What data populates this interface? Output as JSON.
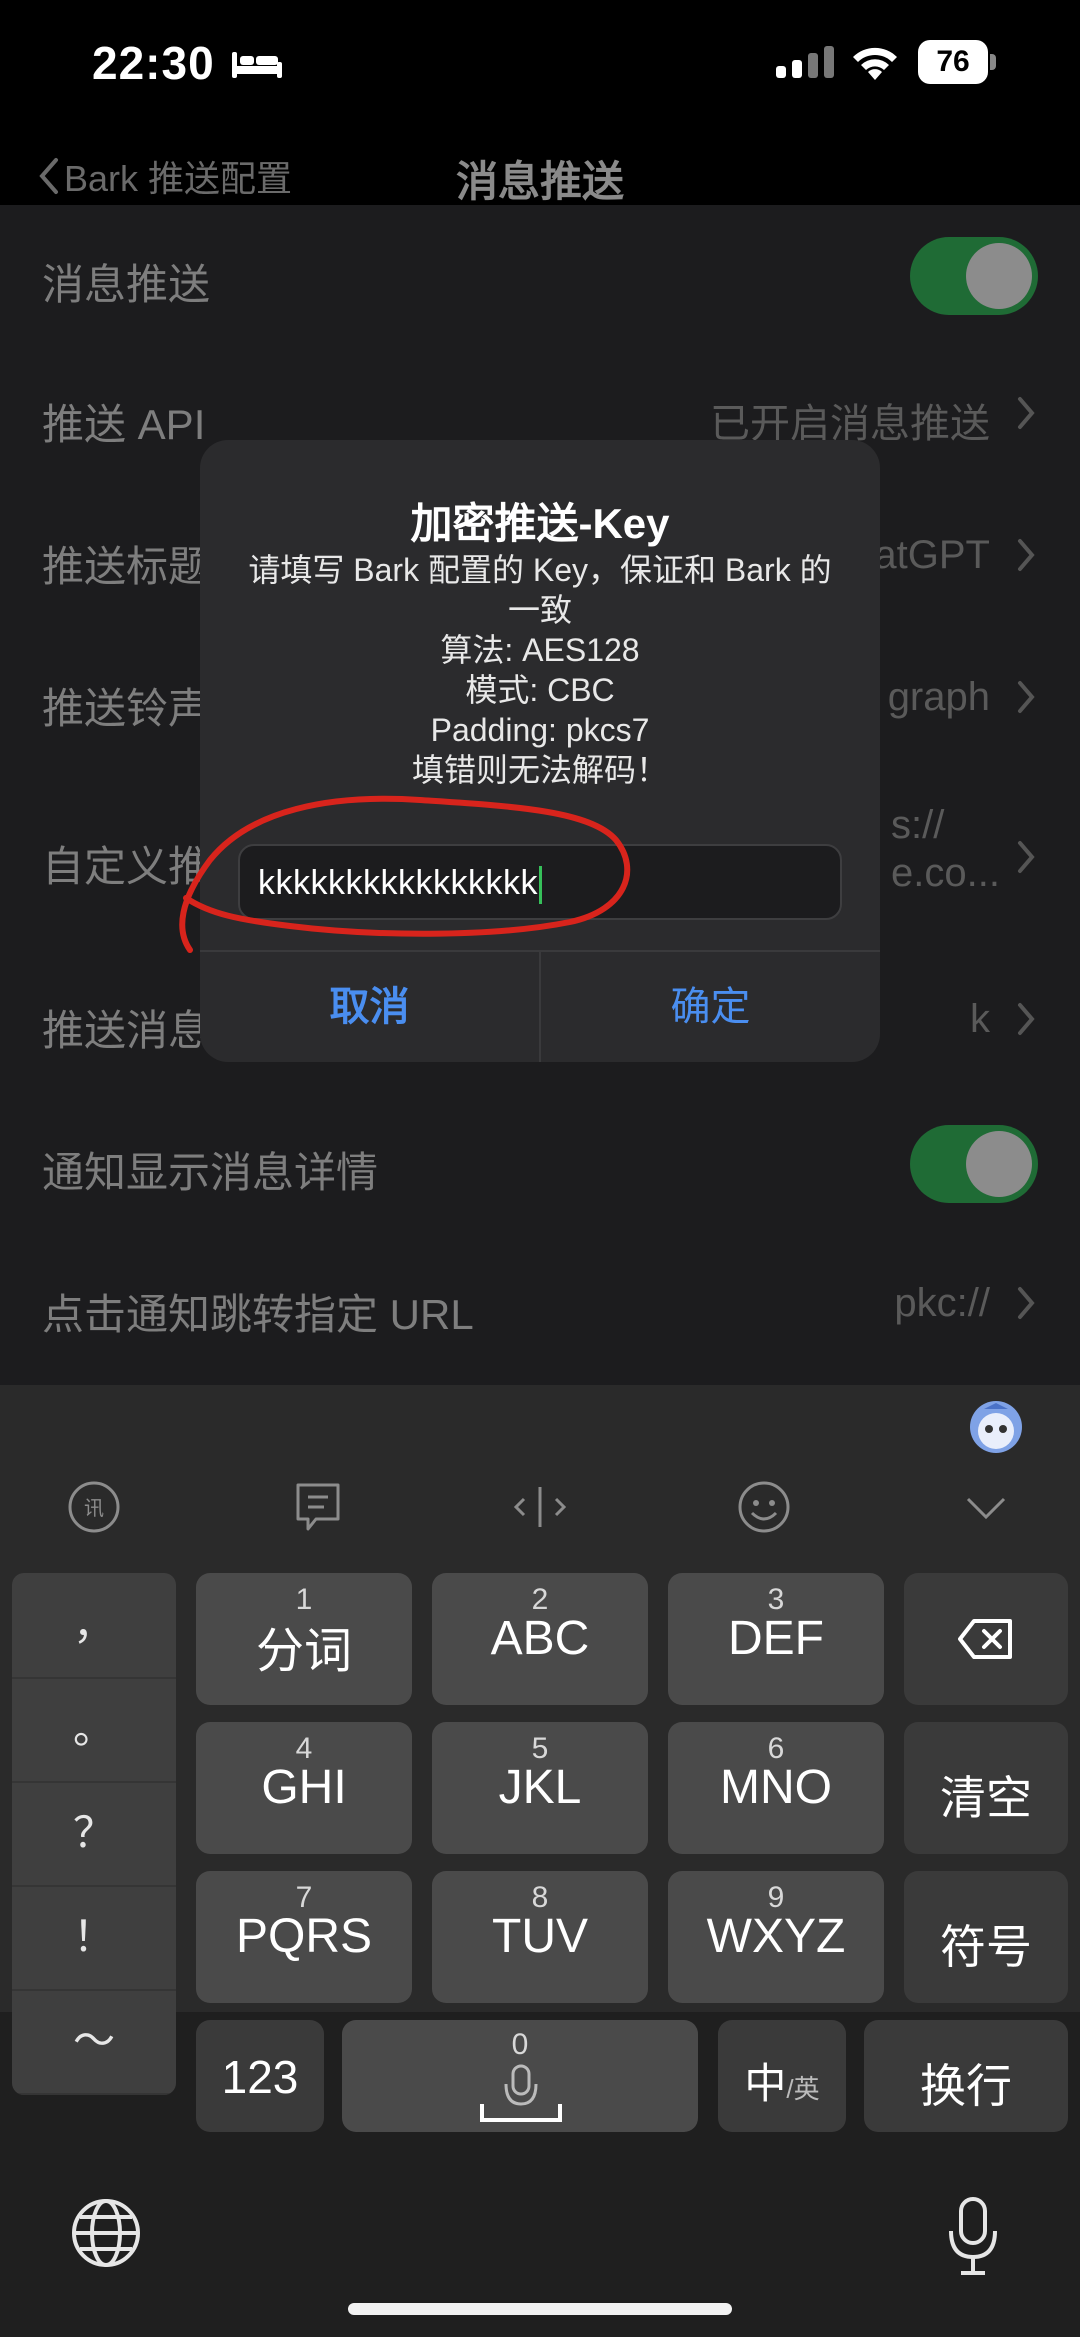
{
  "status_bar": {
    "time": "22:30",
    "battery": "76",
    "icons": [
      "bed-icon",
      "signal-icon",
      "wifi-icon",
      "battery-icon"
    ]
  },
  "nav": {
    "back_label": "Bark 推送配置",
    "title": "消息推送"
  },
  "settings": [
    {
      "label": "消息推送",
      "value": "",
      "type": "toggle",
      "on": true
    },
    {
      "label": "推送 API",
      "value": "已开启消息推送",
      "type": "link"
    },
    {
      "label": "推送标题",
      "value": "atGPT",
      "type": "link"
    },
    {
      "label": "推送铃声",
      "value": "graph",
      "type": "link"
    },
    {
      "label": "自定义推",
      "value": "s://\ne.co...",
      "type": "link"
    },
    {
      "label": "推送消息",
      "value": "k",
      "type": "link"
    },
    {
      "label": "通知显示消息详情",
      "value": "",
      "type": "toggle",
      "on": true
    },
    {
      "label": "点击通知跳转指定 URL",
      "value": "pkc://",
      "type": "link"
    }
  ],
  "dialog": {
    "title": "加密推送-Key",
    "message_lines": [
      "请填写 Bark 配置的 Key，保证和 Bark 的",
      "一致",
      "算法: AES128",
      "模式: CBC",
      "Padding: pkcs7",
      "填错则无法解码！"
    ],
    "input_value": "kkkkkkkkkkkkkkkk",
    "cancel_label": "取消",
    "confirm_label": "确定"
  },
  "keyboard": {
    "toolbar_icons": [
      "voice-input-icon",
      "clipboard-icon",
      "cursor-icon",
      "emoji-icon",
      "collapse-keyboard-icon"
    ],
    "punctuation": [
      "，",
      "。",
      "？",
      "！",
      "～"
    ],
    "keys": {
      "k1": {
        "num": "1",
        "label": "分词"
      },
      "k2": {
        "num": "2",
        "label": "ABC"
      },
      "k3": {
        "num": "3",
        "label": "DEF"
      },
      "k4": {
        "num": "4",
        "label": "GHI"
      },
      "k5": {
        "num": "5",
        "label": "JKL"
      },
      "k6": {
        "num": "6",
        "label": "MNO"
      },
      "k7": {
        "num": "7",
        "label": "PQRS"
      },
      "k8": {
        "num": "8",
        "label": "TUV"
      },
      "k9": {
        "num": "9",
        "label": "WXYZ"
      },
      "clear": "清空",
      "symbols": "符号",
      "num123": "123",
      "space_num": "0",
      "lang_main": "中",
      "lang_sub": "/英",
      "newline": "换行"
    }
  },
  "colors": {
    "accent": "#4a8ef0",
    "toggle_on": "#1f6b35",
    "annotation": "#d8241c"
  }
}
